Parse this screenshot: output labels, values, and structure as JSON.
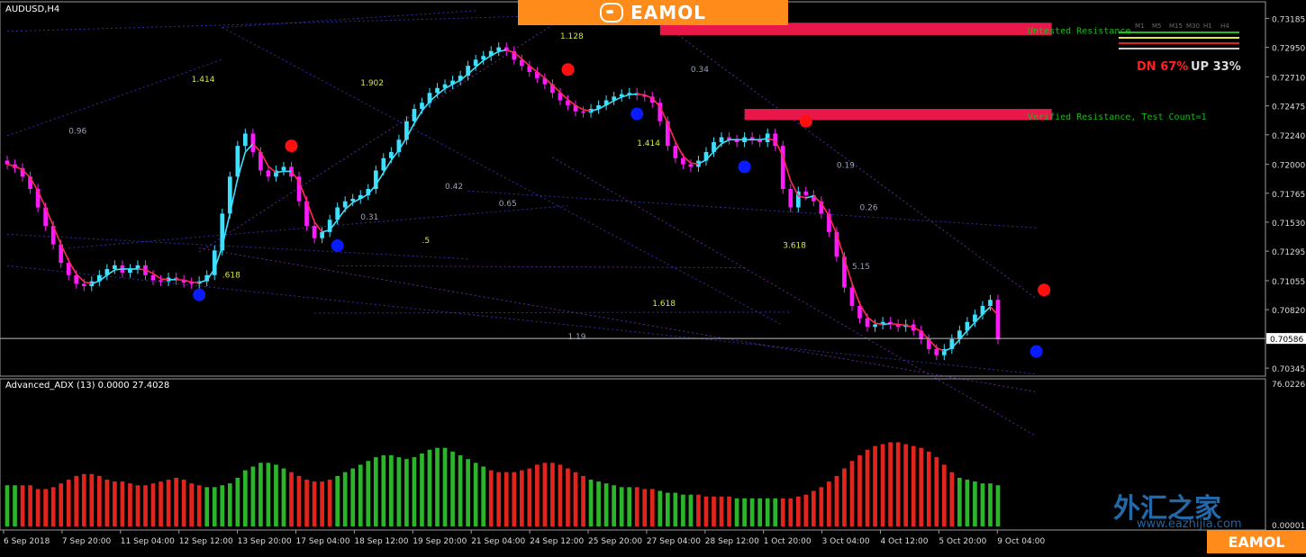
{
  "chart_data": {
    "type": "candlestick",
    "title": "AUDUSD,H4",
    "price_axis": {
      "range": [
        0.7028,
        0.7332
      ],
      "ticks": [
        "0.73185",
        "0.72950",
        "0.72710",
        "0.72475",
        "0.72240",
        "0.72000",
        "0.71765",
        "0.71530",
        "0.71295",
        "0.71055",
        "0.70820",
        "0.70345"
      ],
      "current_price": "0.70586"
    },
    "time_axis": {
      "ticks": [
        "6 Sep 2018",
        "7 Sep 20:00",
        "11 Sep 04:00",
        "12 Sep 12:00",
        "13 Sep 20:00",
        "17 Sep 04:00",
        "18 Sep 12:00",
        "19 Sep 20:00",
        "21 Sep 04:00",
        "24 Sep 12:00",
        "25 Sep 20:00",
        "27 Sep 04:00",
        "28 Sep 12:00",
        "1 Oct 20:00",
        "3 Oct 04:00",
        "4 Oct 12:00",
        "5 Oct 20:00",
        "9 Oct 04:00"
      ]
    },
    "close": [
      0.72,
      0.7197,
      0.719,
      0.718,
      0.7165,
      0.715,
      0.7135,
      0.712,
      0.711,
      0.7103,
      0.7101,
      0.7105,
      0.711,
      0.7115,
      0.7118,
      0.7112,
      0.7115,
      0.7118,
      0.711,
      0.7106,
      0.7105,
      0.7108,
      0.7106,
      0.7104,
      0.7103,
      0.7105,
      0.711,
      0.713,
      0.716,
      0.719,
      0.7215,
      0.7225,
      0.721,
      0.7195,
      0.719,
      0.7195,
      0.7198,
      0.719,
      0.717,
      0.715,
      0.714,
      0.7145,
      0.7155,
      0.7165,
      0.717,
      0.7172,
      0.7175,
      0.718,
      0.7195,
      0.7205,
      0.721,
      0.722,
      0.7235,
      0.7245,
      0.725,
      0.7258,
      0.7262,
      0.7265,
      0.7268,
      0.7272,
      0.728,
      0.7285,
      0.7288,
      0.7292,
      0.7295,
      0.7292,
      0.7285,
      0.728,
      0.7275,
      0.727,
      0.7265,
      0.7258,
      0.7252,
      0.7248,
      0.7243,
      0.7242,
      0.7245,
      0.7248,
      0.7252,
      0.7255,
      0.7257,
      0.7258,
      0.7256,
      0.7255,
      0.725,
      0.7235,
      0.7215,
      0.7205,
      0.72,
      0.7198,
      0.7203,
      0.721,
      0.7218,
      0.7222,
      0.722,
      0.7218,
      0.7222,
      0.722,
      0.7218,
      0.7225,
      0.7215,
      0.718,
      0.7165,
      0.7178,
      0.7175,
      0.717,
      0.716,
      0.7145,
      0.7125,
      0.71,
      0.7085,
      0.7075,
      0.7068,
      0.707,
      0.7072,
      0.707,
      0.7068,
      0.707,
      0.7065,
      0.7058,
      0.705,
      0.7045,
      0.705,
      0.7058,
      0.7065,
      0.7072,
      0.7078,
      0.7085,
      0.709,
      0.7058
    ],
    "signals": [
      {
        "type": "sell",
        "index": 37,
        "price": 0.7215
      },
      {
        "type": "sell",
        "index": 73,
        "price": 0.7277
      },
      {
        "type": "sell",
        "index": 104,
        "price": 0.7235
      },
      {
        "type": "sell",
        "index": 135,
        "price": 0.7098
      },
      {
        "type": "buy",
        "index": 25,
        "price": 0.7094
      },
      {
        "type": "buy",
        "index": 43,
        "price": 0.7134
      },
      {
        "type": "buy",
        "index": 82,
        "price": 0.7241
      },
      {
        "type": "buy",
        "index": 96,
        "price": 0.7198
      },
      {
        "type": "buy",
        "index": 134,
        "price": 0.7048
      }
    ],
    "resistance_zones": [
      {
        "label": "Untested Resistance",
        "from_index": 85,
        "to_index": 136,
        "price_top": 0.7315,
        "price_bottom": 0.7305
      },
      {
        "label": "Verified Resistance, Test Count=1",
        "from_index": 96,
        "to_index": 136,
        "price_top": 0.7245,
        "price_bottom": 0.7236
      }
    ],
    "fib_labels": [
      {
        "text": "1.128",
        "index": 72,
        "price": 0.7302
      },
      {
        "text": "1.414",
        "index": 24,
        "price": 0.7267
      },
      {
        "text": "1.902",
        "index": 46,
        "price": 0.7264
      },
      {
        "text": "0.34",
        "index": 89,
        "price": 0.7275
      },
      {
        "text": "0.96",
        "index": 8,
        "price": 0.7225
      },
      {
        "text": "1.414",
        "index": 82,
        "price": 0.7215
      },
      {
        "text": "0.19",
        "index": 108,
        "price": 0.7197
      },
      {
        "text": "0.42",
        "index": 57,
        "price": 0.718
      },
      {
        "text": "0.26",
        "index": 111,
        "price": 0.7163
      },
      {
        "text": "0.31",
        "index": 46,
        "price": 0.7155
      },
      {
        "text": "0.65",
        "index": 64,
        "price": 0.7166
      },
      {
        "text": ".5",
        "index": 54,
        "price": 0.7136
      },
      {
        "text": "3.618",
        "index": 101,
        "price": 0.7132
      },
      {
        "text": "5.15",
        "index": 110,
        "price": 0.7115
      },
      {
        "text": ".618",
        "index": 28,
        "price": 0.7108
      },
      {
        "text": "1.618",
        "index": 84,
        "price": 0.7085
      },
      {
        "text": "1.19",
        "index": 73,
        "price": 0.7058
      }
    ],
    "sentiment": {
      "down_label": "DN 67%",
      "up_label": "UP 33%"
    },
    "timeframes": [
      "M1",
      "M5",
      "M15",
      "M30",
      "H1",
      "H4"
    ],
    "adx": {
      "title": "Advanced_ADX (13) 0.0000 27.4028",
      "axis_max_label": "76.0226",
      "axis_min_label": "0.00001",
      "values": [
        22,
        22,
        22,
        22,
        20,
        20,
        21,
        23,
        25,
        27,
        28,
        28,
        27,
        25,
        24,
        24,
        23,
        22,
        22,
        23,
        24,
        25,
        26,
        25,
        23,
        22,
        21,
        21,
        22,
        23,
        26,
        30,
        32,
        34,
        34,
        33,
        31,
        29,
        27,
        25,
        24,
        24,
        25,
        27,
        29,
        31,
        33,
        35,
        37,
        38,
        38,
        37,
        36,
        37,
        39,
        41,
        42,
        42,
        40,
        38,
        36,
        34,
        32,
        30,
        29,
        29,
        29,
        30,
        31,
        33,
        34,
        34,
        33,
        31,
        29,
        27,
        25,
        24,
        23,
        22,
        21,
        21,
        21,
        20,
        20,
        19,
        18,
        18,
        17,
        17,
        17,
        16,
        16,
        16,
        16,
        15,
        15,
        15,
        15,
        15,
        15,
        15,
        15,
        16,
        17,
        19,
        21,
        24,
        27,
        31,
        35,
        38,
        41,
        43,
        44,
        45,
        45,
        44,
        43,
        42,
        40,
        37,
        33,
        29,
        26,
        25,
        24,
        23,
        23,
        22
      ],
      "colors": [
        "g",
        "g",
        "r",
        "r",
        "r",
        "r",
        "r",
        "r",
        "r",
        "r",
        "r",
        "r",
        "r",
        "r",
        "r",
        "r",
        "r",
        "r",
        "r",
        "r",
        "r",
        "r",
        "r",
        "r",
        "r",
        "r",
        "g",
        "g",
        "g",
        "g",
        "g",
        "g",
        "g",
        "g",
        "g",
        "g",
        "g",
        "r",
        "r",
        "r",
        "r",
        "r",
        "r",
        "g",
        "g",
        "g",
        "g",
        "g",
        "g",
        "g",
        "g",
        "g",
        "g",
        "g",
        "g",
        "g",
        "g",
        "g",
        "g",
        "g",
        "g",
        "g",
        "g",
        "r",
        "r",
        "r",
        "r",
        "r",
        "r",
        "r",
        "r",
        "r",
        "r",
        "r",
        "r",
        "r",
        "g",
        "g",
        "g",
        "g",
        "g",
        "g",
        "r",
        "r",
        "r",
        "g",
        "g",
        "g",
        "g",
        "g",
        "r",
        "r",
        "r",
        "r",
        "r",
        "g",
        "g",
        "g",
        "g",
        "g",
        "g",
        "r",
        "r",
        "r",
        "r",
        "r",
        "r",
        "r",
        "r",
        "r",
        "r",
        "r",
        "r",
        "r",
        "r",
        "r",
        "r",
        "r",
        "r",
        "r",
        "r",
        "r",
        "r",
        "r",
        "g",
        "g",
        "g",
        "g",
        "g",
        "g",
        "r"
      ],
      "colors_legend": {
        "g": "#2bb52b",
        "r": "#e3241d"
      }
    },
    "colors": {
      "bull": "#3ee0ff",
      "bear": "#ff1aff",
      "ma_up": "#3ee0ff",
      "ma_down": "#ff2a55",
      "sell_dot": "#ff1010",
      "buy_dot": "#0a1cff",
      "zone": "#e8194a",
      "grid": "#000000",
      "text": "#dcdcdc"
    }
  },
  "brand": {
    "top": "EAMOL",
    "bottom": "EAMOL",
    "watermark": "外汇之家",
    "watermark_url": "www.eazhijia.com"
  }
}
